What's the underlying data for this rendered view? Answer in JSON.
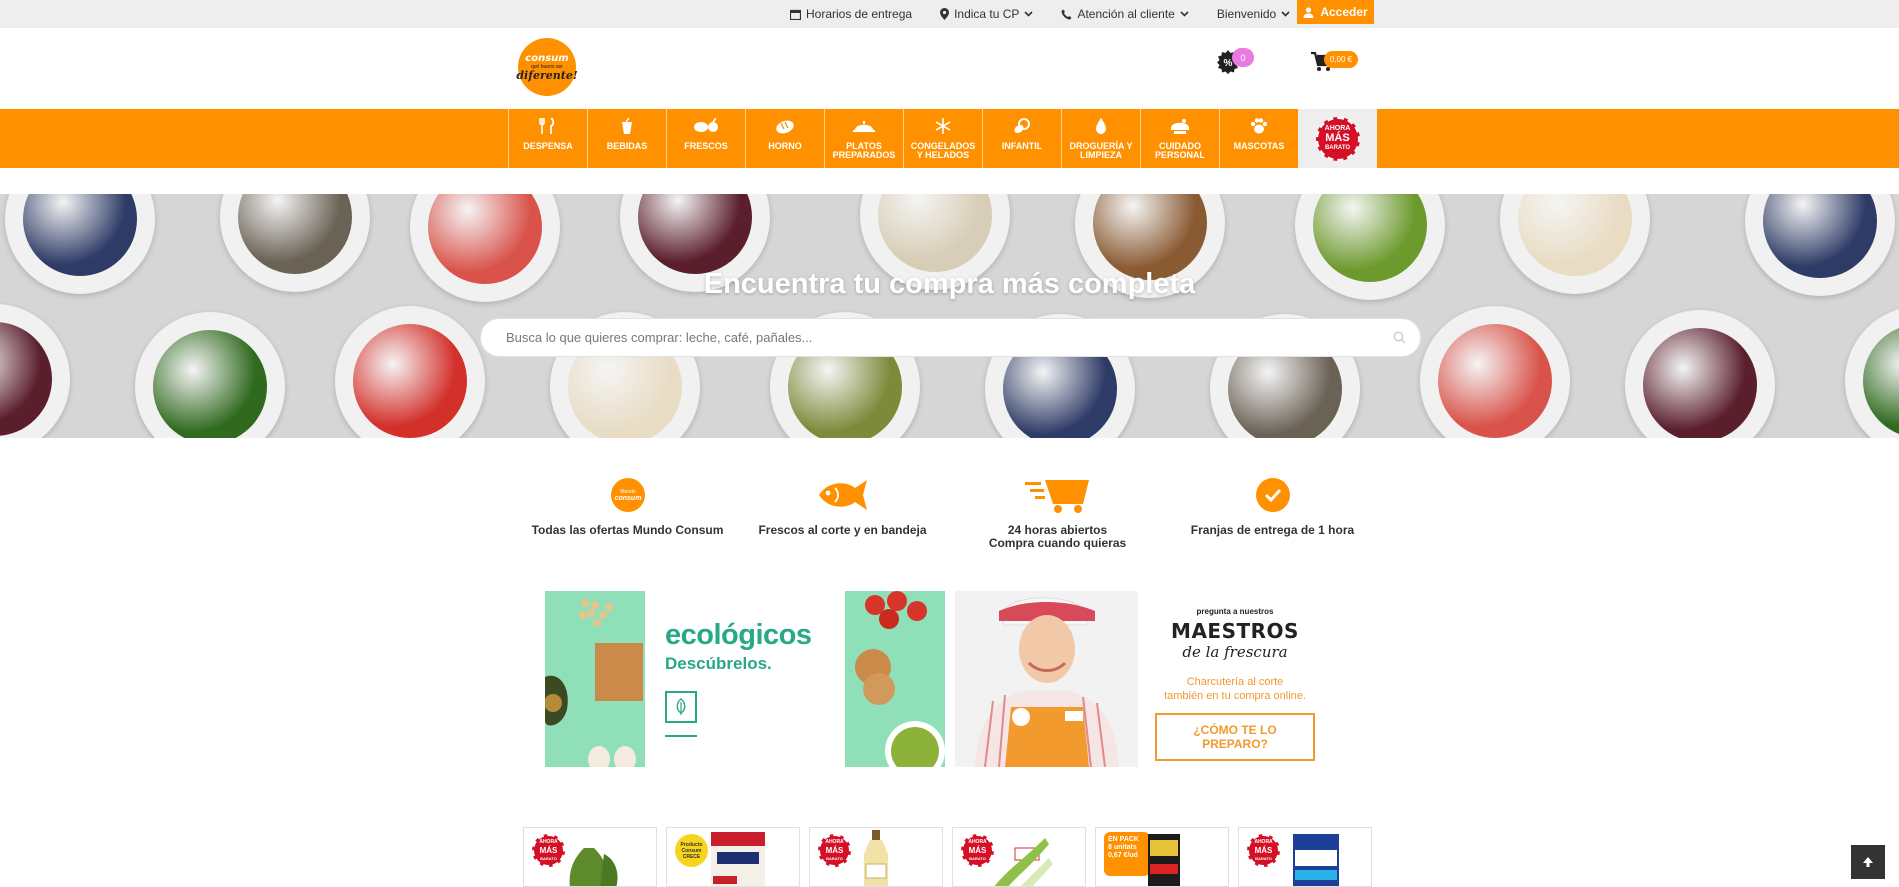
{
  "topbar": {
    "delivery_hours": "Horarios de entrega",
    "postcode": "Indica tu CP",
    "customer_service": "Atención al cliente",
    "welcome": "Bienvenido",
    "login": "Acceder"
  },
  "header": {
    "logo_name": "consum",
    "logo_tagline": "qué bueno ser",
    "logo_script": "diferente!",
    "offers_count": "0",
    "cart_total": "0,00 €"
  },
  "nav": {
    "items": [
      {
        "label": "DESPENSA",
        "icon": "cutlery-icon"
      },
      {
        "label": "BEBIDAS",
        "icon": "cup-icon"
      },
      {
        "label": "FRESCOS",
        "icon": "fresh-icon"
      },
      {
        "label": "HORNO",
        "icon": "bread-icon"
      },
      {
        "label": "PLATOS PREPARADOS",
        "icon": "dish-icon"
      },
      {
        "label": "CONGELADOS Y HELADOS",
        "icon": "snowflake-icon"
      },
      {
        "label": "INFANTIL",
        "icon": "pacifier-icon"
      },
      {
        "label": "DROGUERÍA Y LIMPIEZA",
        "icon": "drop-icon"
      },
      {
        "label": "CUIDADO PERSONAL",
        "icon": "care-icon"
      },
      {
        "label": "MASCOTAS",
        "icon": "paw-icon"
      }
    ],
    "promo": {
      "line1": "AHORA",
      "line2": "MÁS",
      "line3": "BARATO"
    }
  },
  "hero": {
    "title": "Encuentra tu compra más completa",
    "search_placeholder": "Busca lo que quieres comprar: leche, café, pañales..."
  },
  "features": [
    {
      "text": "Todas las ofertas Mundo Consum",
      "icon": "mundo-consum-icon",
      "badge_top": "Mundo",
      "badge_bottom": "consum"
    },
    {
      "text": "Frescos al corte y en bandeja",
      "icon": "fish-icon"
    },
    {
      "text": "24 horas abiertos",
      "text2": "Compra cuando quieras",
      "icon": "delivery-cart-icon"
    },
    {
      "text": "Franjas de entrega de 1 hora",
      "icon": "check-icon"
    }
  ],
  "banners": {
    "eco_title": "ecológicos",
    "eco_subtitle": "Descúbrelos.",
    "maestros_pre": "pregunta a nuestros",
    "maestros_title": "MAESTROS",
    "maestros_subtitle": "de la frescura",
    "maestros_desc1": "Charcutería al corte",
    "maestros_desc2": "también en tu compra online.",
    "maestros_button": "¿CÓMO TE LO PREPARO?"
  },
  "products": {
    "badge": {
      "line1": "AHORA",
      "line2": "MÁS",
      "line3": "BARATO"
    },
    "yellow_badge": "Producto Consum CRECE",
    "pack_badge_1": "EN PACK",
    "pack_badge_2": "8 unitats",
    "pack_badge_3": "0,67 €/ud"
  },
  "colors": {
    "brand_orange": "#ff9100",
    "promo_red": "#d50f25",
    "eco_green": "#27a887"
  }
}
